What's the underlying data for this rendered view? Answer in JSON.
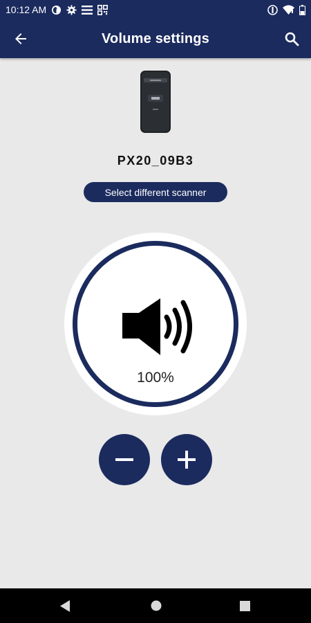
{
  "status_bar": {
    "time": "10:12 AM",
    "icons": [
      "firefox-icon",
      "gear-icon",
      "list-icon",
      "qr-icon",
      "vibrate-icon",
      "wifi-icon",
      "battery-icon"
    ]
  },
  "app_bar": {
    "title": "Volume settings",
    "back_icon": "arrow-left-icon",
    "search_icon": "search-icon"
  },
  "scanner": {
    "name": "PX20_09B3",
    "select_label": "Select different scanner"
  },
  "volume": {
    "level_text": "100%",
    "level": 1.0,
    "icon": "speaker-icon"
  },
  "controls": {
    "decrease_icon": "minus-icon",
    "increase_icon": "plus-icon"
  },
  "nav_bar": {
    "icons": [
      "back-triangle-icon",
      "home-circle-icon",
      "recents-square-icon"
    ]
  },
  "colors": {
    "primary": "#1b2b5e",
    "background": "#e9e9e9",
    "surface": "#ffffff"
  }
}
